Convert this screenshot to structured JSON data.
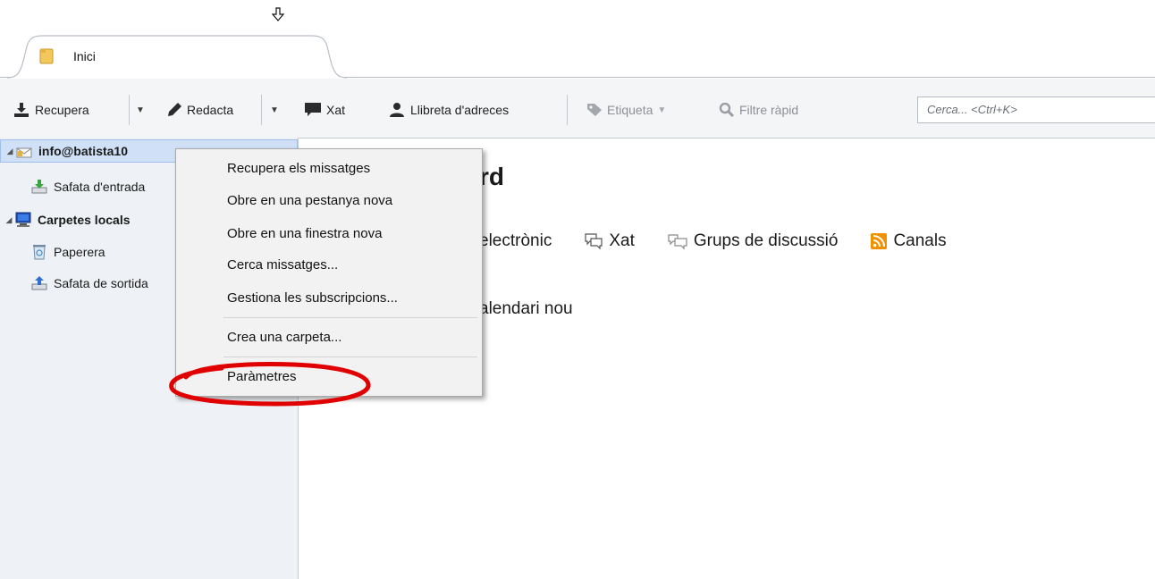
{
  "tab": {
    "label": "Inici"
  },
  "toolbar": {
    "get_messages": "Recupera",
    "write": "Redacta",
    "chat": "Xat",
    "address_book": "Llibreta d'adreces",
    "tag": "Etiqueta",
    "quick_filter": "Filtre ràpid",
    "search_placeholder": "Cerca... <Ctrl+K>"
  },
  "folders": {
    "account": "info@batista10",
    "inbox": "Safata d'entrada",
    "local_folders": "Carpetes locals",
    "trash": "Paperera",
    "outbox": "Safata de sortida"
  },
  "main": {
    "title_tail": "rd",
    "links": {
      "email": "electrònic",
      "chat": "Xat",
      "newsgroups": "Grups de discussió",
      "feeds": "Canals"
    },
    "calendar": "alendari nou"
  },
  "context_menu": {
    "get_messages": "Recupera els missatges",
    "open_new_tab": "Obre en una pestanya nova",
    "open_new_window": "Obre en una finestra nova",
    "search_messages": "Cerca missatges...",
    "subscriptions": "Gestiona les subscripcions...",
    "new_folder": "Crea una carpeta...",
    "settings": "Paràmetres"
  },
  "colors": {
    "highlight_ellipse": "#e00000",
    "selection": "#cfe0f7",
    "feeds_icon": "#f29100"
  }
}
